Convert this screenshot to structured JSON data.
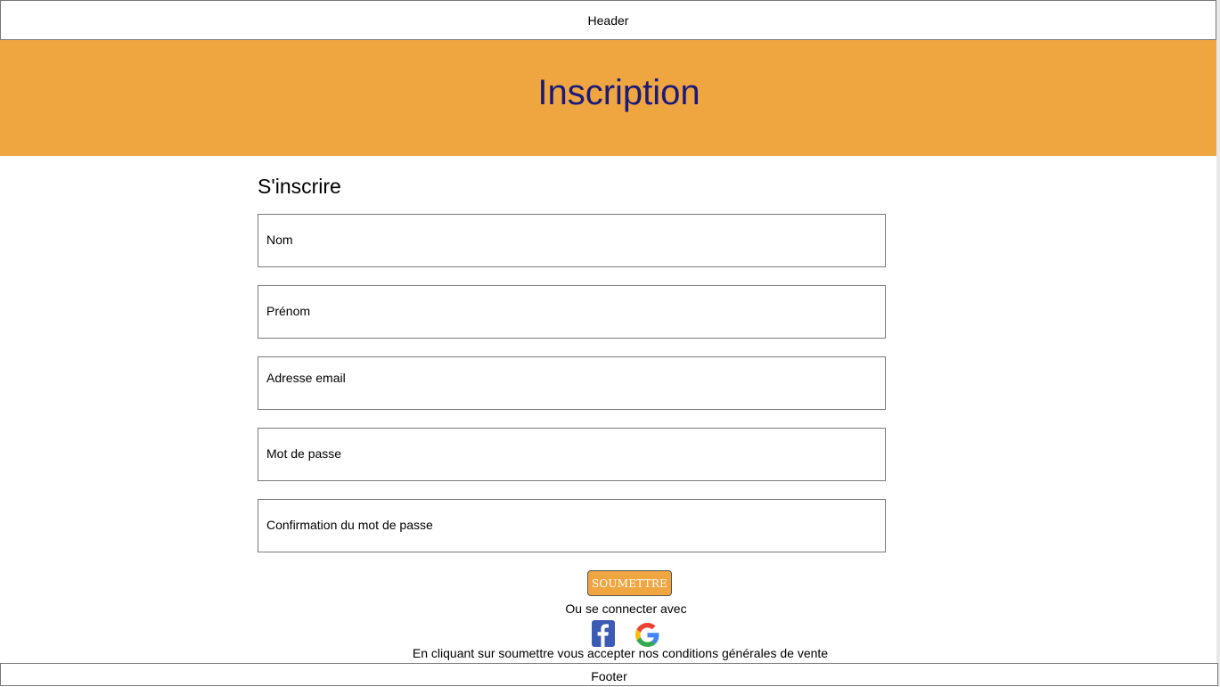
{
  "header": {
    "label": "Header"
  },
  "banner": {
    "title": "Inscription"
  },
  "form": {
    "title": "S'inscrire",
    "fields": [
      {
        "label": "Nom"
      },
      {
        "label": "Prénom"
      },
      {
        "label": "Adresse email"
      },
      {
        "label": "Mot de passe"
      },
      {
        "label": "Confirmation du mot de passe"
      }
    ],
    "submit_label": "SOUMETTRE",
    "alt_login_text": "Ou se connecter avec",
    "social": [
      {
        "icon": "facebook-icon",
        "color": "#3b5bb5"
      },
      {
        "icon": "google-icon"
      }
    ],
    "terms_text": "En cliquant sur soumettre vous accepter nos conditions générales de vente"
  },
  "footer": {
    "label": "Footer"
  },
  "colors": {
    "banner_bg": "#f0a640",
    "title_color": "#1a1a7a",
    "button_bg": "#f0a640"
  }
}
